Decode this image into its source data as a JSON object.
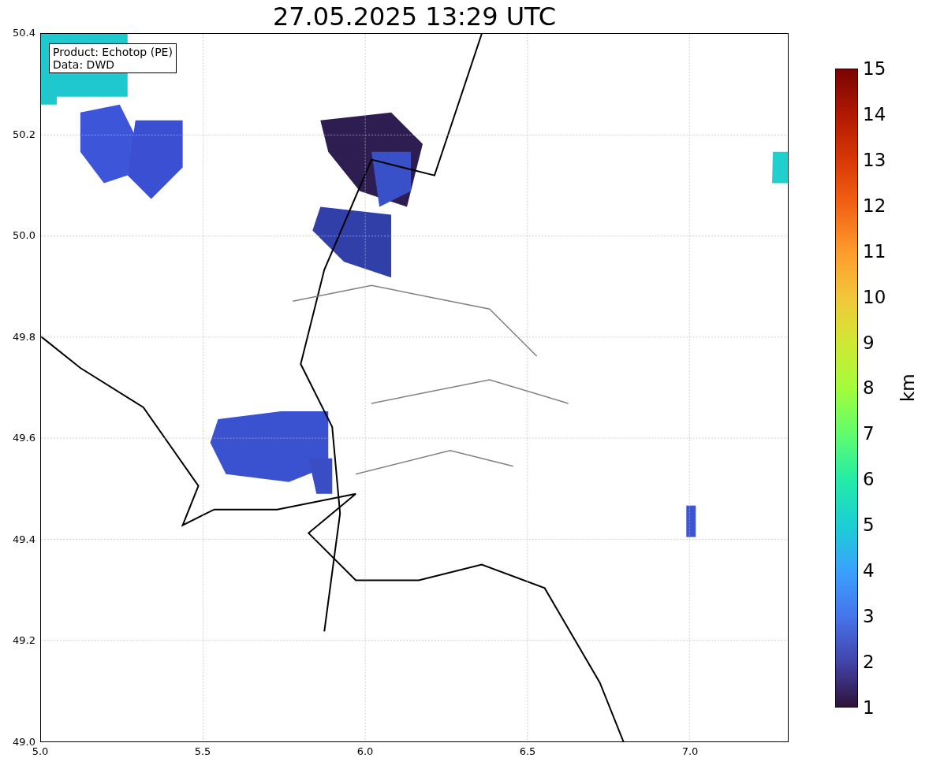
{
  "title": "27.05.2025 13:29 UTC",
  "info_box": [
    "Product: Echotop (PE)",
    "Data: DWD"
  ],
  "y_ticks": [
    "50.4",
    "50.2",
    "50.0",
    "49.8",
    "49.6",
    "49.4",
    "49.2",
    "49.0"
  ],
  "x_ticks": [
    "5.0",
    "5.5",
    "6.0",
    "6.5",
    "7.0"
  ],
  "colorbar": {
    "label": "km",
    "ticks": [
      "15",
      "14",
      "13",
      "12",
      "11",
      "10",
      "9",
      "8",
      "7",
      "6",
      "5",
      "4",
      "3",
      "2",
      "1"
    ]
  }
}
